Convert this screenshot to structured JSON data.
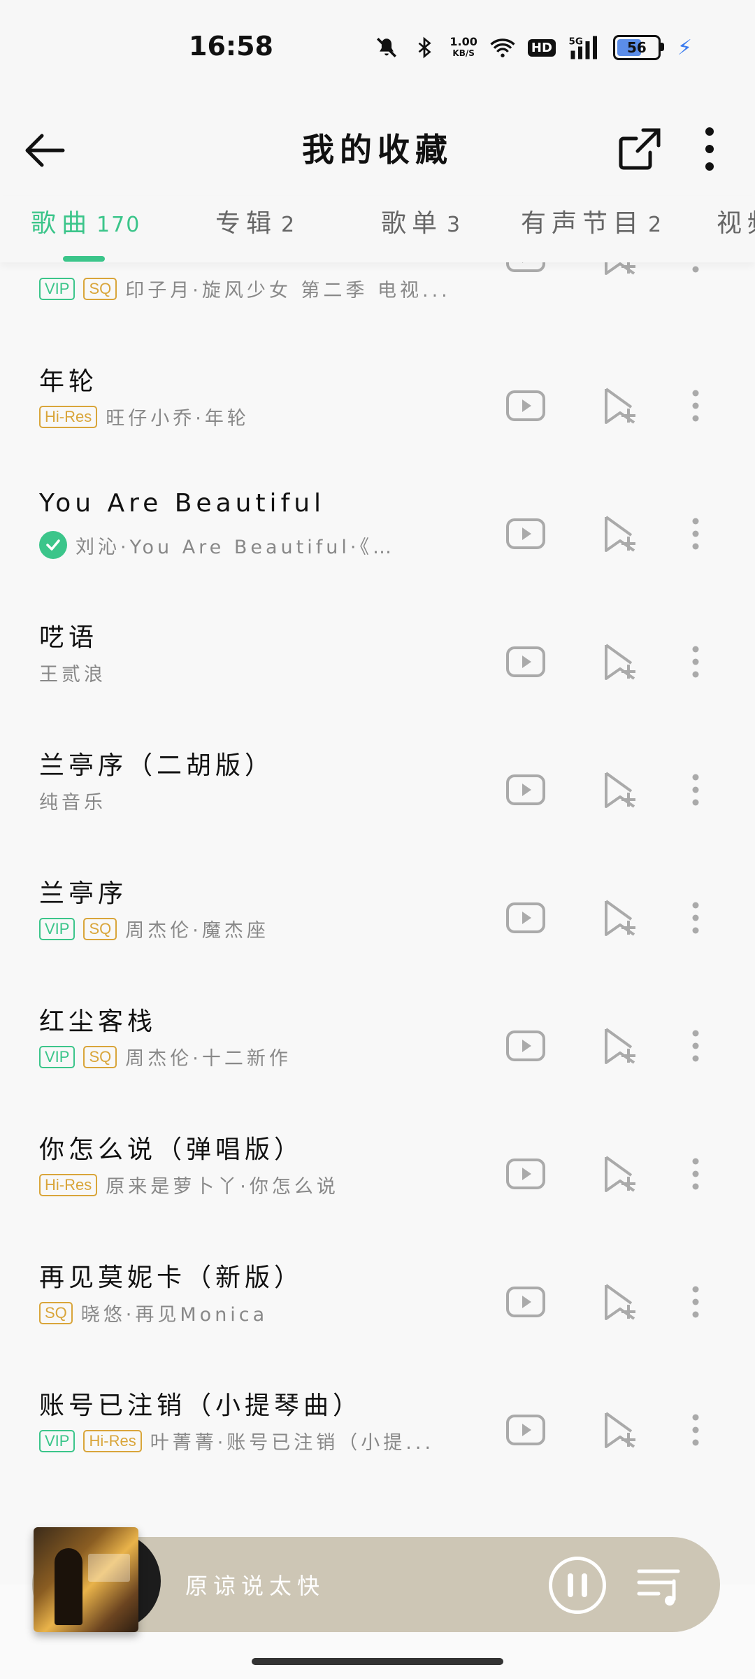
{
  "status": {
    "time": "16:58",
    "net_top": "1.00",
    "net_bottom": "KB/S",
    "signal": "5G",
    "hd": "HD",
    "battery": "56"
  },
  "header": {
    "title": "我的收藏"
  },
  "tabs": [
    {
      "label": "歌曲",
      "count": "170"
    },
    {
      "label": "专辑",
      "count": "2"
    },
    {
      "label": "歌单",
      "count": "3"
    },
    {
      "label": "有声节目",
      "count": "2"
    },
    {
      "label": "视频",
      "count": ""
    }
  ],
  "badges": {
    "vip": "VIP",
    "sq": "SQ",
    "hires": "Hi-Res"
  },
  "songs": [
    {
      "title": "",
      "sub": "印子月·旋风少女 第二季 电视..."
    },
    {
      "title": "年轮",
      "sub": "旺仔小乔·年轮"
    },
    {
      "title": "You Are Beautiful",
      "sub": "刘沁·You Are Beautiful·《寒武纪》网..."
    },
    {
      "title": "呓语",
      "sub": "王贰浪"
    },
    {
      "title": "兰亭序（二胡版）",
      "sub": "纯音乐"
    },
    {
      "title": "兰亭序",
      "sub": "周杰伦·魔杰座"
    },
    {
      "title": "红尘客栈",
      "sub": "周杰伦·十二新作"
    },
    {
      "title": "你怎么说（弹唱版）",
      "sub": "原来是萝卜丫·你怎么说"
    },
    {
      "title": "再见莫妮卡（新版）",
      "sub": "晓悠·再见Monica"
    },
    {
      "title": "账号已注销（小提琴曲）",
      "sub": "叶菁菁·账号已注销（小提..."
    }
  ],
  "player": {
    "now_playing": "原谅说太快"
  },
  "colors": {
    "accent": "#3bc58a",
    "gold": "#d9a53a",
    "player_bg": "#cdc6b5"
  }
}
